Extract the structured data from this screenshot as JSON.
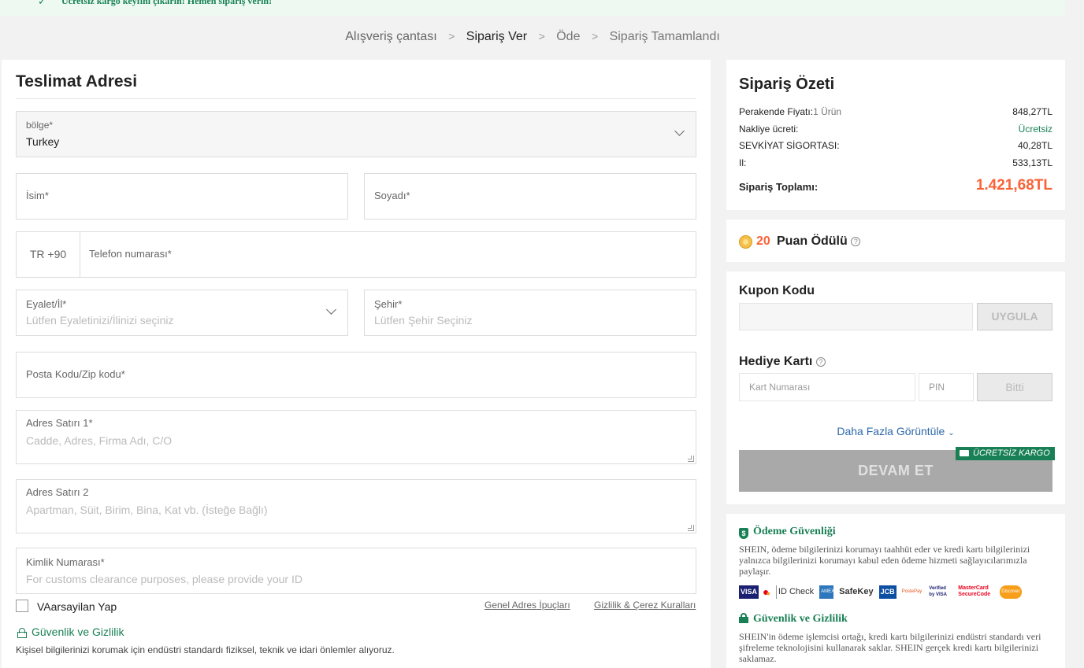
{
  "banner": {
    "text": "Ücretsiz kargo keyfini çıkarın! Hemen sipariş verin!"
  },
  "breadcrumb": {
    "steps": [
      "Alışveriş çantası",
      "Sipariş Ver",
      "Öde",
      "Sipariş Tamamlandı"
    ],
    "separator": ">",
    "active_index": 1
  },
  "address": {
    "title": "Teslimat Adresi",
    "region": {
      "label": "bölge*",
      "value": "Turkey"
    },
    "first_name": {
      "label": "İsim*"
    },
    "last_name": {
      "label": "Soyadı*"
    },
    "phone": {
      "code": "TR +90",
      "label": "Telefon numarası*"
    },
    "state": {
      "label": "Eyalet/İl*",
      "placeholder": "Lütfen Eyaletinizi/İlinizi seçiniz"
    },
    "city": {
      "label": "Şehir*",
      "placeholder": "Lütfen Şehir Seçiniz"
    },
    "postal": {
      "label": "Posta Kodu/Zip kodu*"
    },
    "line1": {
      "label": "Adres Satırı 1*",
      "placeholder": "Cadde, Adres, Firma Adı, C/O"
    },
    "line2": {
      "label": "Adres Satırı 2",
      "placeholder": "Apartman, Süit, Birim, Bina, Kat vb. (İsteğe Bağlı)"
    },
    "id_number": {
      "label": "Kimlik Numarası*",
      "placeholder": "For customs clearance purposes, please provide your ID"
    },
    "default_label": "VAarsayilan Yap",
    "tips_link": "Genel Adres İpuçları",
    "privacy_link": "Gizlilik & Çerez Kuralları",
    "security_title": "Güvenlik ve Gizlilik",
    "security_desc": "Kişisel bilgilerinizi korumak için endüstri standardı fiziksel, teknik ve idari önlemler alıyoruz."
  },
  "summary": {
    "title": "Sipariş Özeti",
    "rows": [
      {
        "label": "Perakende Fiyatı:",
        "sub": "1 Ürün",
        "value": "848,27TL"
      },
      {
        "label": "Nakliye ücreti:",
        "value": "Ücretsiz"
      },
      {
        "label": "SEVKİYAT SİGORTASI:",
        "value": "40,28TL"
      },
      {
        "label": "Il:",
        "value": "533,13TL"
      }
    ],
    "total_label": "Sipariş Toplamı:",
    "total_value": "1.421,68TL"
  },
  "points": {
    "amount": "20",
    "label": "Puan Ödülü",
    "help": "?"
  },
  "coupon": {
    "title": "Kupon Kodu",
    "apply_label": "UYGULA",
    "gift_title": "Hediye Kartı",
    "card_placeholder": "Kart Numarası",
    "pin_placeholder": "PIN",
    "done_label": "Bitti",
    "more_label": "Daha Fazla Görüntüle",
    "continue_label": "DEVAM ET",
    "free_shipping_badge": "ÜCRETSİZ KARGO"
  },
  "security_card": {
    "payment_title": "Ödeme Güvenliği",
    "payment_text": "SHEIN, ödeme bilgilerinizi korumayı taahhüt eder ve kredi kartı bilgilerinizi yalnızca bilgilerinizi korumayı kabul eden ödeme hizmeti sağlayıcılarımızla paylaşır.",
    "badges": [
      "VISA",
      "mastercard",
      "ID Check",
      "AMEX",
      "SafeKey",
      "JCB",
      "PostePay",
      "Verified by VISA",
      "MasterCard SecureCode",
      "Discover"
    ],
    "privacy_title": "Güvenlik ve Gizlilik",
    "privacy_text": "SHEIN'in ödeme işlemcisi ortağı, kredi kartı bilgilerinizi endüstri standardı veri şifreleme teknolojisini kullanarak saklar. SHEIN gerçek kredi kartı bilgilerinizi saklamaz."
  },
  "colors": {
    "brand_green": "#198055",
    "price_orange": "#fa6338",
    "link_blue": "#2d68a8"
  }
}
